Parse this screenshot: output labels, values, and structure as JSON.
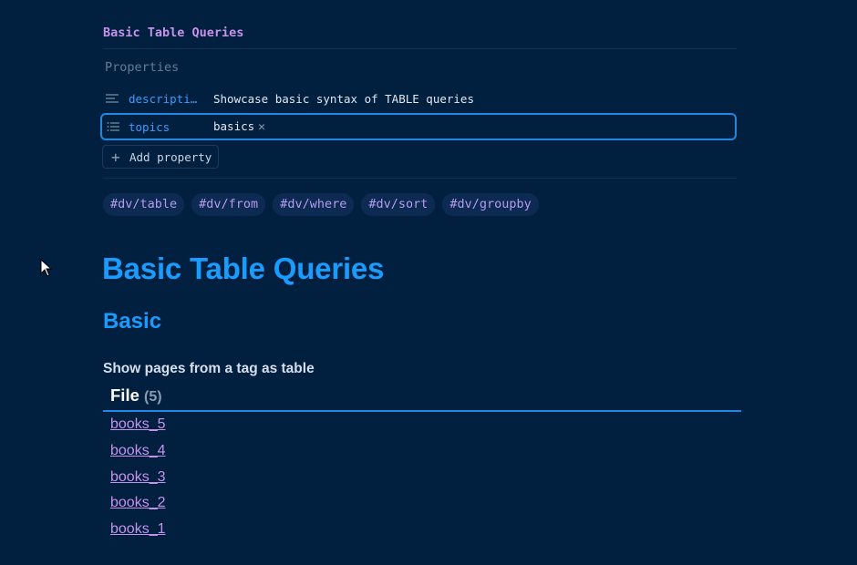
{
  "note": {
    "inline_title": "Basic Table Queries"
  },
  "properties": {
    "heading": "Properties",
    "items": [
      {
        "key": "descripti…",
        "value": "Showcase basic syntax of TABLE queries",
        "icon": "text-lines-icon"
      },
      {
        "key": "topics",
        "value": "basics",
        "icon": "list-icon"
      }
    ],
    "add_label": "Add property"
  },
  "tags": [
    "#dv/table",
    "#dv/from",
    "#dv/where",
    "#dv/sort",
    "#dv/groupby"
  ],
  "content": {
    "h1": "Basic Table Queries",
    "h2": "Basic",
    "bold_line": "Show pages from a tag  as table"
  },
  "table": {
    "header": "File",
    "count": "(5)",
    "rows": [
      "books_5",
      "books_4",
      "books_3",
      "books_2",
      "books_1"
    ]
  },
  "colors": {
    "background": "#01203f",
    "heading": "#1a9cff",
    "link": "#c792ea",
    "accent_border": "#1e88e5"
  }
}
